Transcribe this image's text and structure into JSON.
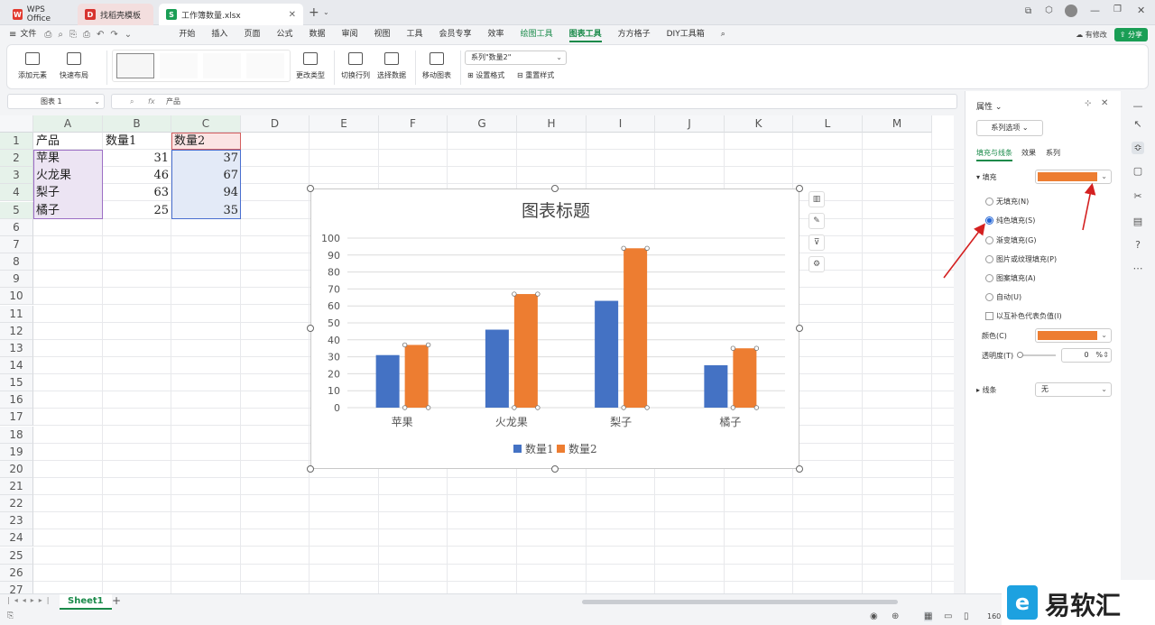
{
  "tabs": [
    {
      "label": "WPS Office",
      "icon": "wps-logo-icon"
    },
    {
      "label": "找稻壳模板",
      "icon": "docer-icon"
    },
    {
      "label": "工作簿数量.xlsx",
      "icon": "spreadsheet-icon"
    }
  ],
  "menu": {
    "file": "文件",
    "items": [
      "开始",
      "插入",
      "页面",
      "公式",
      "数据",
      "审阅",
      "视图",
      "工具",
      "会员专享",
      "效率",
      "绘图工具",
      "图表工具",
      "方方格子",
      "DIY工具箱"
    ],
    "active": "图表工具",
    "has_edit": "有修改",
    "share": "分享"
  },
  "ribbon": {
    "add_element": "添加元素",
    "quick_layout": "快速布局",
    "change_type": "更改类型",
    "switch_rowcol": "切换行列",
    "select_data": "选择数据",
    "move_chart": "移动图表",
    "series_select": "系列\"数量2\"",
    "set_format": "设置格式",
    "reset_style": "重置样式"
  },
  "formula_bar": {
    "name_box": "图表 1",
    "fx": "fx",
    "content": "产品"
  },
  "columns": [
    "A",
    "B",
    "C",
    "D",
    "E",
    "F",
    "G",
    "H",
    "I",
    "J",
    "K",
    "L",
    "M"
  ],
  "rows": [
    "1",
    "2",
    "3",
    "4",
    "5",
    "6",
    "7",
    "8",
    "9",
    "10",
    "11",
    "12",
    "13",
    "14",
    "15",
    "16",
    "17",
    "18",
    "19",
    "20",
    "21",
    "22",
    "23",
    "24",
    "25",
    "26",
    "27"
  ],
  "cells": {
    "A1": "产品",
    "B1": "数量1",
    "C1": "数量2",
    "A2": "苹果",
    "B2": "31",
    "C2": "37",
    "A3": "火龙果",
    "B3": "46",
    "C3": "67",
    "A4": "梨子",
    "B4": "63",
    "C4": "94",
    "A5": "橘子",
    "B5": "25",
    "C5": "35"
  },
  "chart_data": {
    "type": "bar",
    "title": "图表标题",
    "categories": [
      "苹果",
      "火龙果",
      "梨子",
      "橘子"
    ],
    "series": [
      {
        "name": "数量1",
        "values": [
          31,
          46,
          63,
          25
        ],
        "color": "#4472c4"
      },
      {
        "name": "数量2",
        "values": [
          37,
          67,
          94,
          35
        ],
        "color": "#ed7d31"
      }
    ],
    "ylim": [
      0,
      100
    ],
    "yticks": [
      "0",
      "10",
      "20",
      "30",
      "40",
      "50",
      "60",
      "70",
      "80",
      "90",
      "100"
    ],
    "grid": true,
    "legend": "bottom"
  },
  "panel": {
    "title": "属性",
    "series_options": "系列选项",
    "tabs": [
      "填充与线条",
      "效果",
      "系列"
    ],
    "fill_label": "填充",
    "fill_color": "#ed7d31",
    "fill_options": [
      "无填充(N)",
      "纯色填充(S)",
      "渐变填充(G)",
      "图片或纹理填充(P)",
      "图案填充(A)",
      "自动(U)"
    ],
    "selected_option": "纯色填充(S)",
    "invert_label": "以互补色代表负值(I)",
    "color_label": "颜色(C)",
    "transparency_label": "透明度(T)",
    "transparency_value": "0",
    "percent": "%",
    "line_label": "线条",
    "line_value": "无"
  },
  "sheet_tab": "Sheet1",
  "zoom": "160",
  "watermark": "易软汇",
  "accent": "#1a8a4a"
}
